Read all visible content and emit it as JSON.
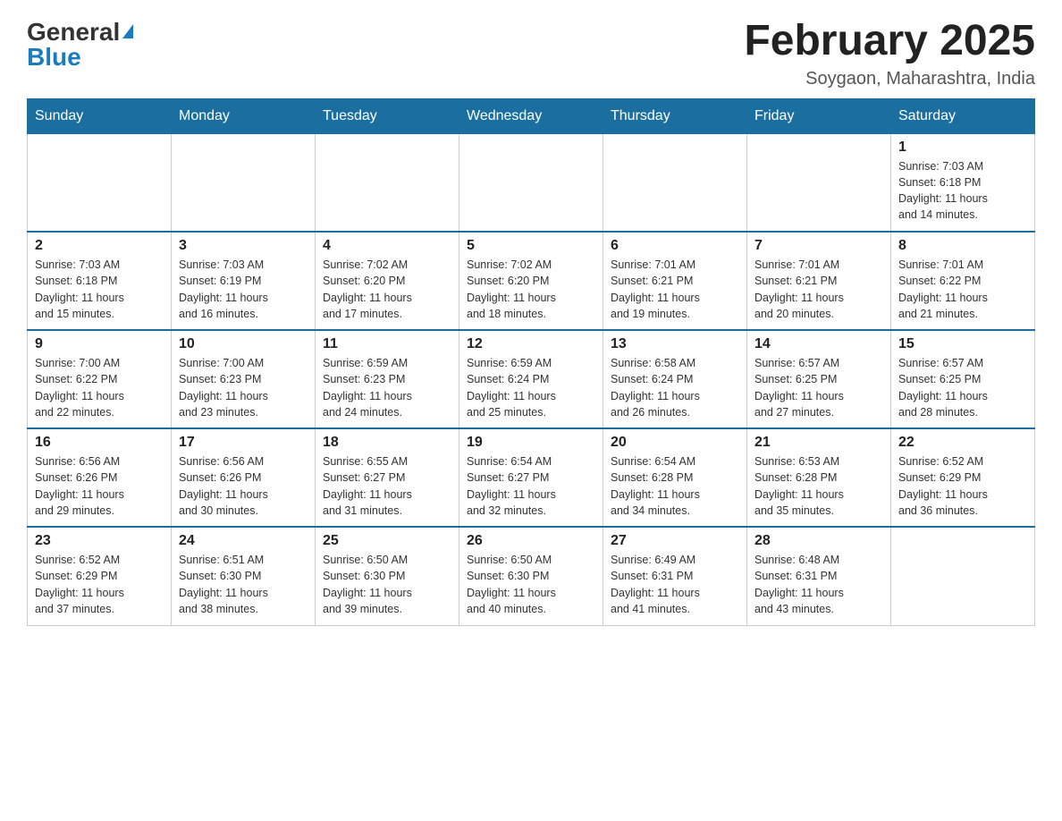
{
  "header": {
    "logo_general": "General",
    "logo_blue": "Blue",
    "month_title": "February 2025",
    "location": "Soygaon, Maharashtra, India"
  },
  "weekdays": [
    "Sunday",
    "Monday",
    "Tuesday",
    "Wednesday",
    "Thursday",
    "Friday",
    "Saturday"
  ],
  "weeks": [
    [
      {
        "day": "",
        "info": ""
      },
      {
        "day": "",
        "info": ""
      },
      {
        "day": "",
        "info": ""
      },
      {
        "day": "",
        "info": ""
      },
      {
        "day": "",
        "info": ""
      },
      {
        "day": "",
        "info": ""
      },
      {
        "day": "1",
        "info": "Sunrise: 7:03 AM\nSunset: 6:18 PM\nDaylight: 11 hours\nand 14 minutes."
      }
    ],
    [
      {
        "day": "2",
        "info": "Sunrise: 7:03 AM\nSunset: 6:18 PM\nDaylight: 11 hours\nand 15 minutes."
      },
      {
        "day": "3",
        "info": "Sunrise: 7:03 AM\nSunset: 6:19 PM\nDaylight: 11 hours\nand 16 minutes."
      },
      {
        "day": "4",
        "info": "Sunrise: 7:02 AM\nSunset: 6:20 PM\nDaylight: 11 hours\nand 17 minutes."
      },
      {
        "day": "5",
        "info": "Sunrise: 7:02 AM\nSunset: 6:20 PM\nDaylight: 11 hours\nand 18 minutes."
      },
      {
        "day": "6",
        "info": "Sunrise: 7:01 AM\nSunset: 6:21 PM\nDaylight: 11 hours\nand 19 minutes."
      },
      {
        "day": "7",
        "info": "Sunrise: 7:01 AM\nSunset: 6:21 PM\nDaylight: 11 hours\nand 20 minutes."
      },
      {
        "day": "8",
        "info": "Sunrise: 7:01 AM\nSunset: 6:22 PM\nDaylight: 11 hours\nand 21 minutes."
      }
    ],
    [
      {
        "day": "9",
        "info": "Sunrise: 7:00 AM\nSunset: 6:22 PM\nDaylight: 11 hours\nand 22 minutes."
      },
      {
        "day": "10",
        "info": "Sunrise: 7:00 AM\nSunset: 6:23 PM\nDaylight: 11 hours\nand 23 minutes."
      },
      {
        "day": "11",
        "info": "Sunrise: 6:59 AM\nSunset: 6:23 PM\nDaylight: 11 hours\nand 24 minutes."
      },
      {
        "day": "12",
        "info": "Sunrise: 6:59 AM\nSunset: 6:24 PM\nDaylight: 11 hours\nand 25 minutes."
      },
      {
        "day": "13",
        "info": "Sunrise: 6:58 AM\nSunset: 6:24 PM\nDaylight: 11 hours\nand 26 minutes."
      },
      {
        "day": "14",
        "info": "Sunrise: 6:57 AM\nSunset: 6:25 PM\nDaylight: 11 hours\nand 27 minutes."
      },
      {
        "day": "15",
        "info": "Sunrise: 6:57 AM\nSunset: 6:25 PM\nDaylight: 11 hours\nand 28 minutes."
      }
    ],
    [
      {
        "day": "16",
        "info": "Sunrise: 6:56 AM\nSunset: 6:26 PM\nDaylight: 11 hours\nand 29 minutes."
      },
      {
        "day": "17",
        "info": "Sunrise: 6:56 AM\nSunset: 6:26 PM\nDaylight: 11 hours\nand 30 minutes."
      },
      {
        "day": "18",
        "info": "Sunrise: 6:55 AM\nSunset: 6:27 PM\nDaylight: 11 hours\nand 31 minutes."
      },
      {
        "day": "19",
        "info": "Sunrise: 6:54 AM\nSunset: 6:27 PM\nDaylight: 11 hours\nand 32 minutes."
      },
      {
        "day": "20",
        "info": "Sunrise: 6:54 AM\nSunset: 6:28 PM\nDaylight: 11 hours\nand 34 minutes."
      },
      {
        "day": "21",
        "info": "Sunrise: 6:53 AM\nSunset: 6:28 PM\nDaylight: 11 hours\nand 35 minutes."
      },
      {
        "day": "22",
        "info": "Sunrise: 6:52 AM\nSunset: 6:29 PM\nDaylight: 11 hours\nand 36 minutes."
      }
    ],
    [
      {
        "day": "23",
        "info": "Sunrise: 6:52 AM\nSunset: 6:29 PM\nDaylight: 11 hours\nand 37 minutes."
      },
      {
        "day": "24",
        "info": "Sunrise: 6:51 AM\nSunset: 6:30 PM\nDaylight: 11 hours\nand 38 minutes."
      },
      {
        "day": "25",
        "info": "Sunrise: 6:50 AM\nSunset: 6:30 PM\nDaylight: 11 hours\nand 39 minutes."
      },
      {
        "day": "26",
        "info": "Sunrise: 6:50 AM\nSunset: 6:30 PM\nDaylight: 11 hours\nand 40 minutes."
      },
      {
        "day": "27",
        "info": "Sunrise: 6:49 AM\nSunset: 6:31 PM\nDaylight: 11 hours\nand 41 minutes."
      },
      {
        "day": "28",
        "info": "Sunrise: 6:48 AM\nSunset: 6:31 PM\nDaylight: 11 hours\nand 43 minutes."
      },
      {
        "day": "",
        "info": ""
      }
    ]
  ]
}
